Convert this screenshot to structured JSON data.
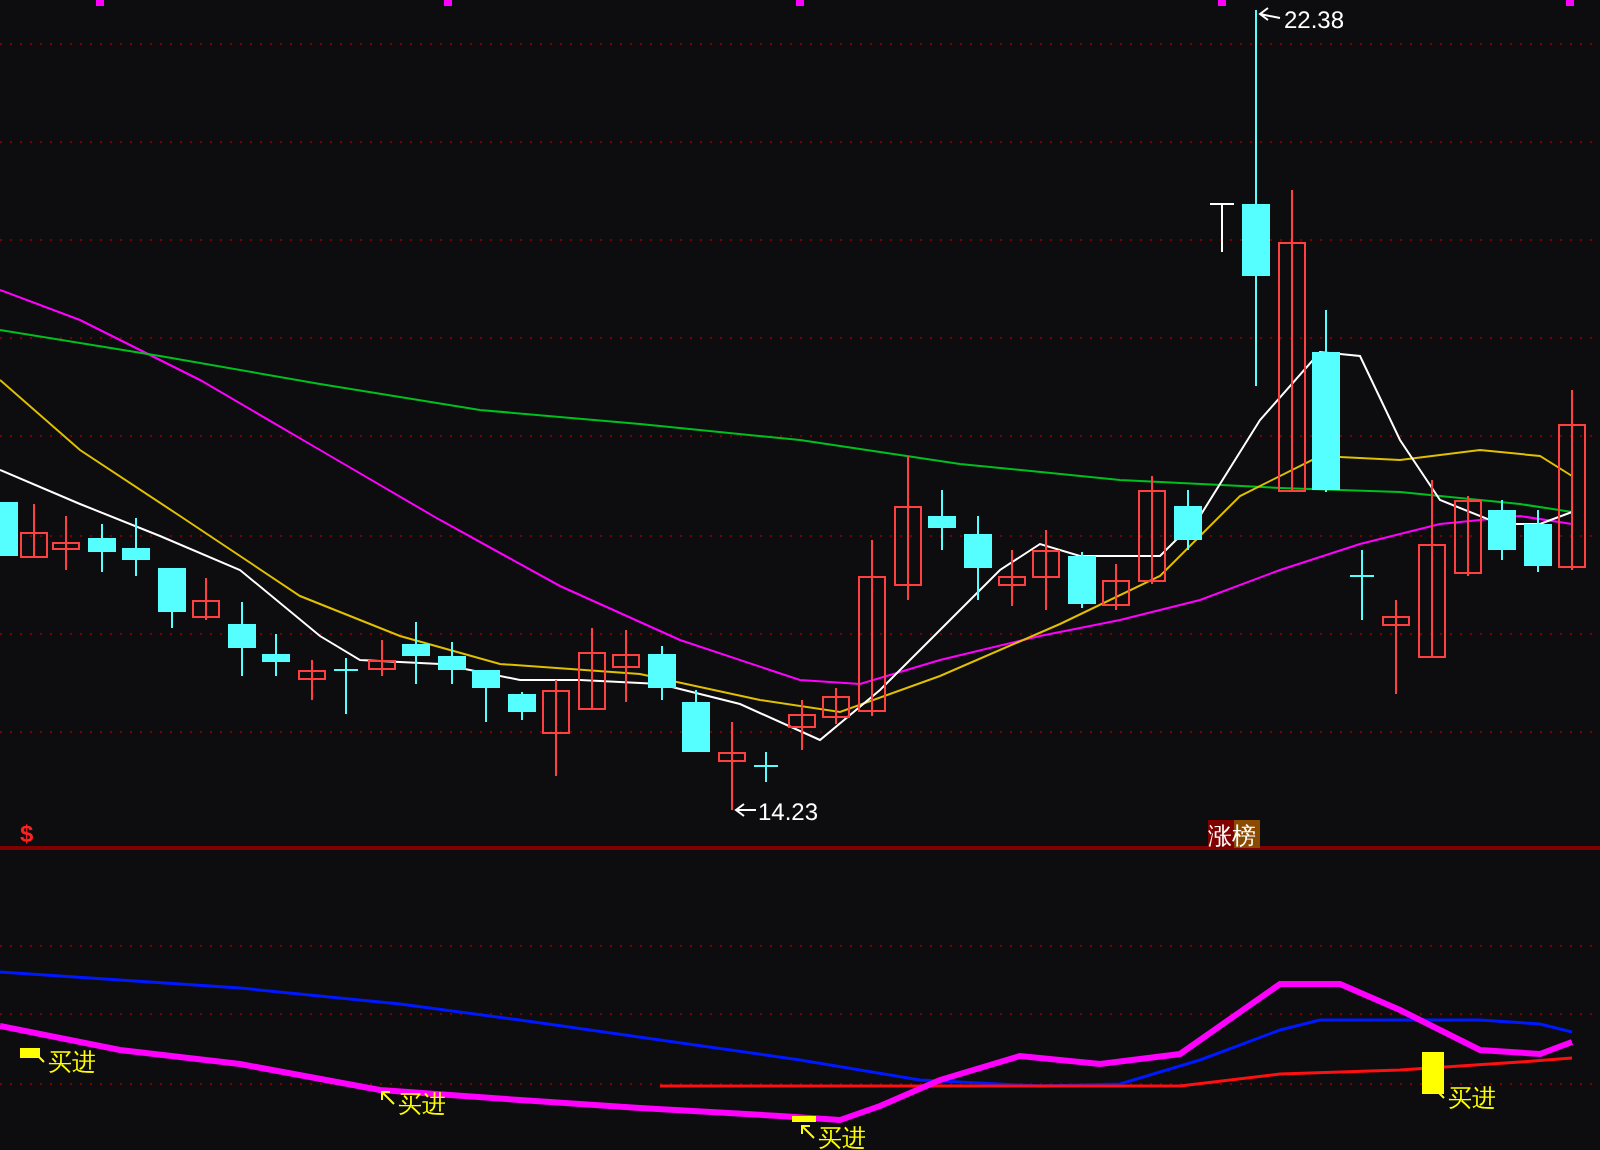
{
  "price_chart": {
    "high_label": "22.38",
    "low_label": "14.23"
  },
  "indicator_panel": {
    "signal_mark": "$",
    "ranking_badge": "涨榜",
    "buy_signals": [
      {
        "label": "买进",
        "kind": "flag"
      },
      {
        "label": "买进",
        "kind": "plain"
      },
      {
        "label": "买进",
        "kind": "flag"
      },
      {
        "label": "买进",
        "kind": "bar"
      }
    ]
  }
}
